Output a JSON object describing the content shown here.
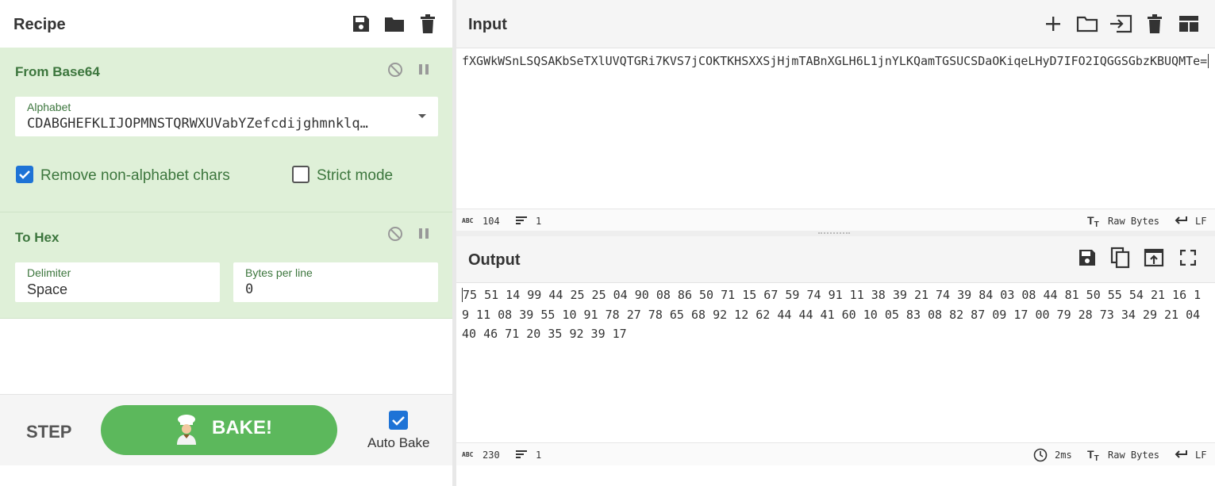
{
  "recipe": {
    "title": "Recipe",
    "operations": [
      {
        "name": "From Base64",
        "alphabet_label": "Alphabet",
        "alphabet_value": "CDABGHEFKLIJOPMNSTQRWXUVabYZefcdijghmnklq…",
        "remove_label": "Remove non-alphabet chars",
        "strict_label": "Strict mode"
      },
      {
        "name": "To Hex",
        "delimiter_label": "Delimiter",
        "delimiter_value": "Space",
        "bytes_label": "Bytes per line",
        "bytes_value": "0"
      }
    ],
    "step_label": "STEP",
    "bake_label": "BAKE!",
    "autobake_label": "Auto Bake"
  },
  "input": {
    "title": "Input",
    "text": "fXGWkWSnLSQSAKbSeTXlUVQTGRi7KVS7jCOKTKHSXXSjHjmTABnXGLH6L1jnYLKQamTGSUCSDaOKiqeLHyD7IFO2IQGGSGbzKBUQMTe=",
    "char_count": "104",
    "line_count": "1",
    "encoding": "Raw Bytes",
    "eol": "LF"
  },
  "output": {
    "title": "Output",
    "text": "75 51 14 99 44 25 25 04 90 08 86 50 71 15 67 59 74 91 11 38 39 21 74 39 84 03 08 44 81 50 55 54 21 16 19 11 08 39 55 10 91 78 27 78 65 68 92 12 62 44 44 41 60 10 05 83 08 82 87 09 17 00 79 28 73 34 29 21 04 40 46 71 20 35 92 39 17",
    "char_count": "230",
    "line_count": "1",
    "time": "2ms",
    "encoding": "Raw Bytes",
    "eol": "LF"
  },
  "colors": {
    "accent_green": "#5cb85c",
    "op_background": "#dff0d8",
    "op_text": "#3c763d",
    "checkbox_blue": "#1e73d6"
  },
  "icons": {
    "recipe": [
      "save-icon",
      "folder-icon",
      "trash-icon"
    ],
    "input": [
      "plus-icon",
      "folder-icon",
      "import-icon",
      "trash-icon",
      "layout-icon"
    ],
    "output": [
      "save-icon",
      "copy-icon",
      "replace-input-icon",
      "maximize-icon"
    ],
    "operation": [
      "disable-icon",
      "pause-icon"
    ]
  }
}
